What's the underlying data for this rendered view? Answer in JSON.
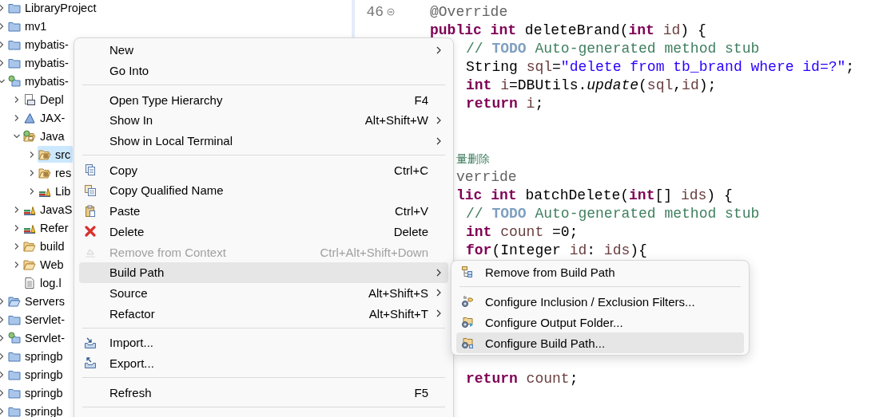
{
  "tree": {
    "items": [
      {
        "label": "LibraryProject",
        "kind": "project",
        "expanded": false,
        "selected": false
      },
      {
        "label": "mv1",
        "kind": "project",
        "expanded": false,
        "selected": false
      },
      {
        "label": "mybatis-",
        "kind": "project",
        "expanded": false,
        "selected": false
      },
      {
        "label": "mybatis-",
        "kind": "project",
        "expanded": false,
        "selected": false
      },
      {
        "label": "mybatis-",
        "kind": "web-project",
        "expanded": true,
        "selected": false,
        "children": [
          {
            "label": "Depl",
            "kind": "deploy",
            "expanded": false,
            "selected": false
          },
          {
            "label": "JAX-",
            "kind": "service",
            "expanded": false,
            "selected": false
          },
          {
            "label": "Java",
            "kind": "java-resources",
            "expanded": true,
            "selected": false,
            "children": [
              {
                "label": "src",
                "kind": "source-folder",
                "expanded": false,
                "selected": true
              },
              {
                "label": "res",
                "kind": "source-folder",
                "expanded": false,
                "selected": false
              },
              {
                "label": "Lib",
                "kind": "library",
                "expanded": false,
                "selected": false
              }
            ]
          },
          {
            "label": "JavaS",
            "kind": "library",
            "expanded": false,
            "selected": false
          },
          {
            "label": "Refer",
            "kind": "library",
            "expanded": false,
            "selected": false
          },
          {
            "label": "build",
            "kind": "folder",
            "expanded": false,
            "selected": false
          },
          {
            "label": "Web",
            "kind": "folder",
            "expanded": false,
            "selected": false
          },
          {
            "label": "log.l",
            "kind": "file",
            "selected": false
          }
        ]
      },
      {
        "label": "Servers",
        "kind": "servers",
        "expanded": false,
        "selected": false
      },
      {
        "label": "Servlet-",
        "kind": "project",
        "expanded": false,
        "selected": false
      },
      {
        "label": "Servlet-",
        "kind": "web-project",
        "expanded": false,
        "selected": false
      },
      {
        "label": "springb",
        "kind": "project",
        "expanded": false,
        "selected": false
      },
      {
        "label": "springb",
        "kind": "project",
        "expanded": false,
        "selected": false
      },
      {
        "label": "springb",
        "kind": "project",
        "expanded": false,
        "selected": false
      },
      {
        "label": "springb",
        "kind": "project",
        "expanded": false,
        "selected": false
      }
    ]
  },
  "editor": {
    "lines": [
      {
        "number": "46",
        "fold": true,
        "kind": "member",
        "tokens": [
          {
            "kind": "a",
            "text": "@Override"
          }
        ]
      },
      {
        "fold": false,
        "kind": "member",
        "tokens": [
          {
            "kind": "k",
            "text": "public"
          },
          {
            "kind": "k",
            "text": " int"
          },
          {
            "kind": "p",
            "text": " deleteBrand("
          },
          {
            "kind": "k",
            "text": "int"
          },
          {
            "kind": "v",
            "text": " id"
          },
          {
            "kind": "p",
            "text": ") {"
          }
        ]
      },
      {
        "fold": false,
        "kind": "body",
        "tokens": [
          {
            "kind": "c",
            "text": "// "
          },
          {
            "kind": "t",
            "text": "TODO"
          },
          {
            "kind": "c",
            "text": " Auto-generated method stub"
          }
        ]
      },
      {
        "fold": false,
        "kind": "body",
        "tokens": [
          {
            "kind": "p",
            "text": "String "
          },
          {
            "kind": "v",
            "text": "sql"
          },
          {
            "kind": "p",
            "text": "="
          },
          {
            "kind": "s",
            "text": "\"delete from tb_brand where id=?\""
          },
          {
            "kind": "p",
            "text": ";"
          }
        ]
      },
      {
        "fold": false,
        "kind": "body",
        "tokens": [
          {
            "kind": "k",
            "text": "int"
          },
          {
            "kind": "v",
            "text": " i"
          },
          {
            "kind": "p",
            "text": "=DBUtils."
          },
          {
            "kind": "i",
            "text": "update"
          },
          {
            "kind": "p",
            "text": "("
          },
          {
            "kind": "v",
            "text": "sql"
          },
          {
            "kind": "p",
            "text": ","
          },
          {
            "kind": "v",
            "text": "id"
          },
          {
            "kind": "p",
            "text": ");"
          }
        ]
      },
      {
        "fold": false,
        "kind": "body",
        "tokens": [
          {
            "kind": "k",
            "text": "return"
          },
          {
            "kind": "v",
            "text": " i"
          },
          {
            "kind": "p",
            "text": ";"
          }
        ]
      },
      {
        "fold": false,
        "kind": "blank"
      },
      {
        "fold": false,
        "kind": "blank"
      },
      {
        "fold": false,
        "kind": "cut",
        "tokens": [
          {
            "kind": "n",
            "text": "量删除"
          }
        ]
      },
      {
        "fold": false,
        "kind": "cut",
        "tokens": [
          {
            "kind": "a",
            "text": "verride"
          }
        ]
      },
      {
        "fold": false,
        "kind": "cut",
        "tokens": [
          {
            "kind": "k",
            "text": "lic"
          },
          {
            "kind": "k",
            "text": " int"
          },
          {
            "kind": "p",
            "text": " batchDelete("
          },
          {
            "kind": "k",
            "text": "int"
          },
          {
            "kind": "p",
            "text": "[] "
          },
          {
            "kind": "v",
            "text": "ids"
          },
          {
            "kind": "p",
            "text": ") {"
          }
        ]
      },
      {
        "fold": false,
        "kind": "body",
        "tokens": [
          {
            "kind": "c",
            "text": "// "
          },
          {
            "kind": "t",
            "text": "TODO"
          },
          {
            "kind": "c",
            "text": " Auto-generated method stub"
          }
        ]
      },
      {
        "fold": false,
        "kind": "body",
        "tokens": [
          {
            "kind": "k",
            "text": "int"
          },
          {
            "kind": "v",
            "text": " count"
          },
          {
            "kind": "p",
            "text": " =0;"
          }
        ]
      },
      {
        "fold": false,
        "kind": "body",
        "tokens": [
          {
            "kind": "k",
            "text": "for"
          },
          {
            "kind": "p",
            "text": "(Integer "
          },
          {
            "kind": "v",
            "text": "id"
          },
          {
            "kind": "p",
            "text": ": "
          },
          {
            "kind": "v",
            "text": "ids"
          },
          {
            "kind": "p",
            "text": "){"
          }
        ]
      },
      {
        "fold": false,
        "kind": "blank"
      },
      {
        "fold": false,
        "kind": "blank"
      },
      {
        "fold": false,
        "kind": "blank"
      },
      {
        "fold": false,
        "kind": "blank"
      },
      {
        "fold": false,
        "kind": "blank"
      },
      {
        "fold": false,
        "kind": "blank"
      },
      {
        "fold": false,
        "kind": "body",
        "tokens": [
          {
            "kind": "k",
            "text": "return"
          },
          {
            "kind": "v",
            "text": " count"
          },
          {
            "kind": "p",
            "text": ";"
          }
        ]
      }
    ]
  },
  "menu": {
    "items": [
      {
        "kind": "plain",
        "label": "New",
        "submenu": true,
        "selected": false,
        "disabled": false
      },
      {
        "kind": "plain",
        "label": "Go Into",
        "submenu": false,
        "selected": false,
        "disabled": false
      },
      {
        "kind": "separator"
      },
      {
        "kind": "plain",
        "label": "Open Type Hierarchy",
        "shortcut": "F4",
        "submenu": false,
        "selected": false,
        "disabled": false
      },
      {
        "kind": "plain",
        "label": "Show In",
        "shortcut": "Alt+Shift+W",
        "submenu": true,
        "selected": false,
        "disabled": false
      },
      {
        "kind": "plain",
        "label": "Show in Local Terminal",
        "submenu": true,
        "selected": false,
        "disabled": false
      },
      {
        "kind": "separator"
      },
      {
        "kind": "copy",
        "label": "Copy",
        "shortcut": "Ctrl+C",
        "submenu": false,
        "selected": false,
        "disabled": false
      },
      {
        "kind": "copy-name",
        "label": "Copy Qualified Name",
        "submenu": false,
        "selected": false,
        "disabled": false
      },
      {
        "kind": "paste",
        "label": "Paste",
        "shortcut": "Ctrl+V",
        "submenu": false,
        "selected": false,
        "disabled": false
      },
      {
        "kind": "delete",
        "label": "Delete",
        "shortcut": "Delete",
        "submenu": false,
        "selected": false,
        "disabled": false
      },
      {
        "kind": "remove",
        "label": "Remove from Context",
        "shortcut": "Ctrl+Alt+Shift+Down",
        "submenu": false,
        "selected": false,
        "disabled": true
      },
      {
        "kind": "plain",
        "label": "Build Path",
        "submenu": true,
        "selected": true,
        "disabled": false
      },
      {
        "kind": "plain",
        "label": "Source",
        "shortcut": "Alt+Shift+S",
        "submenu": true,
        "selected": false,
        "disabled": false
      },
      {
        "kind": "plain",
        "label": "Refactor",
        "shortcut": "Alt+Shift+T",
        "submenu": true,
        "selected": false,
        "disabled": false
      },
      {
        "kind": "separator"
      },
      {
        "kind": "import",
        "label": "Import...",
        "submenu": false,
        "selected": false,
        "disabled": false
      },
      {
        "kind": "export",
        "label": "Export...",
        "submenu": false,
        "selected": false,
        "disabled": false
      },
      {
        "kind": "separator"
      },
      {
        "kind": "plain",
        "label": "Refresh",
        "shortcut": "F5",
        "submenu": false,
        "selected": false,
        "disabled": false
      },
      {
        "kind": "separator"
      }
    ]
  },
  "submenu": {
    "items": [
      {
        "kind": "remove-build",
        "label": "Remove from Build Path",
        "selected": false
      },
      {
        "kind": "separator"
      },
      {
        "kind": "filters",
        "label": "Configure Inclusion / Exclusion Filters...",
        "selected": false
      },
      {
        "kind": "output",
        "label": "Configure Output Folder...",
        "selected": false
      },
      {
        "kind": "build-path",
        "label": "Configure Build Path...",
        "selected": true
      }
    ]
  }
}
